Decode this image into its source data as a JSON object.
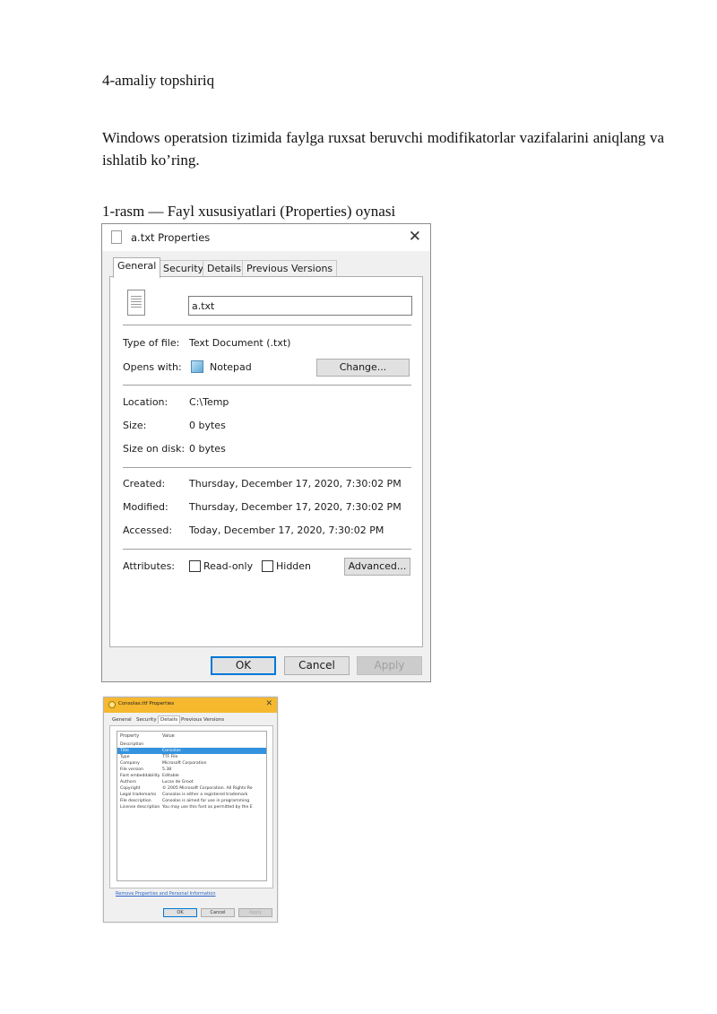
{
  "doc": {
    "heading": "4-amaliy topshiriq",
    "paragraph": "Windows operatsion tizimida faylga ruxsat beruvchi modifikatorlar vazifalarini aniqlang va ishlatib ko’ring.",
    "caption": "1-rasm — Fayl xususiyatlari (Properties) oynasi"
  },
  "dialog": {
    "title": "a.txt Properties",
    "close": "✕",
    "tabs": [
      "General",
      "Security",
      "Details",
      "Previous Versions"
    ],
    "filename": "a.txt",
    "type_label": "Type of file:",
    "type_value": "Text Document (.txt)",
    "opens_label": "Opens with:",
    "opens_value": "Notepad",
    "change_btn": "Change...",
    "location_label": "Location:",
    "location_value": "C:\\Temp",
    "size_label": "Size:",
    "size_value": "0 bytes",
    "disk_label": "Size on disk:",
    "disk_value": "0 bytes",
    "created_label": "Created:",
    "created_value": "Thursday, December 17, 2020, 7:30:02 PM",
    "modified_label": "Modified:",
    "modified_value": "Thursday, December 17, 2020, 7:30:02 PM",
    "accessed_label": "Accessed:",
    "accessed_value": "Today, December 17, 2020, 7:30:02 PM",
    "attributes_label": "Attributes:",
    "readonly_label": "Read-only",
    "hidden_label": "Hidden",
    "advanced_btn": "Advanced...",
    "ok_btn": "OK",
    "cancel_btn": "Cancel",
    "apply_btn": "Apply"
  },
  "dialog2": {
    "title": "Consolas.ttf Properties",
    "close": "✕",
    "tabs": [
      "General",
      "Security",
      "Details",
      "Previous Versions"
    ],
    "col_property": "Property",
    "col_value": "Value",
    "rows": [
      {
        "p": "Description",
        "v": ""
      },
      {
        "p": "Title",
        "v": "Consolas"
      },
      {
        "p": "Type",
        "v": "TTF File"
      },
      {
        "p": "Company",
        "v": "Microsoft Corporation"
      },
      {
        "p": "File version",
        "v": "5.38"
      },
      {
        "p": "Font embeddability",
        "v": "Editable"
      },
      {
        "p": "Authors",
        "v": "Lucas de Groot"
      },
      {
        "p": "Copyright",
        "v": "© 2005 Microsoft Corporation. All Rights Re"
      },
      {
        "p": "Legal trademarks",
        "v": "Consolas is either a registered trademark"
      },
      {
        "p": "File description",
        "v": "Consolas is aimed for use in programming"
      },
      {
        "p": "License description",
        "v": "You may use this font as permitted by the E"
      }
    ],
    "link": "Remove Properties and Personal Information",
    "ok_btn": "OK",
    "cancel_btn": "Cancel",
    "apply_btn": "Apply"
  }
}
